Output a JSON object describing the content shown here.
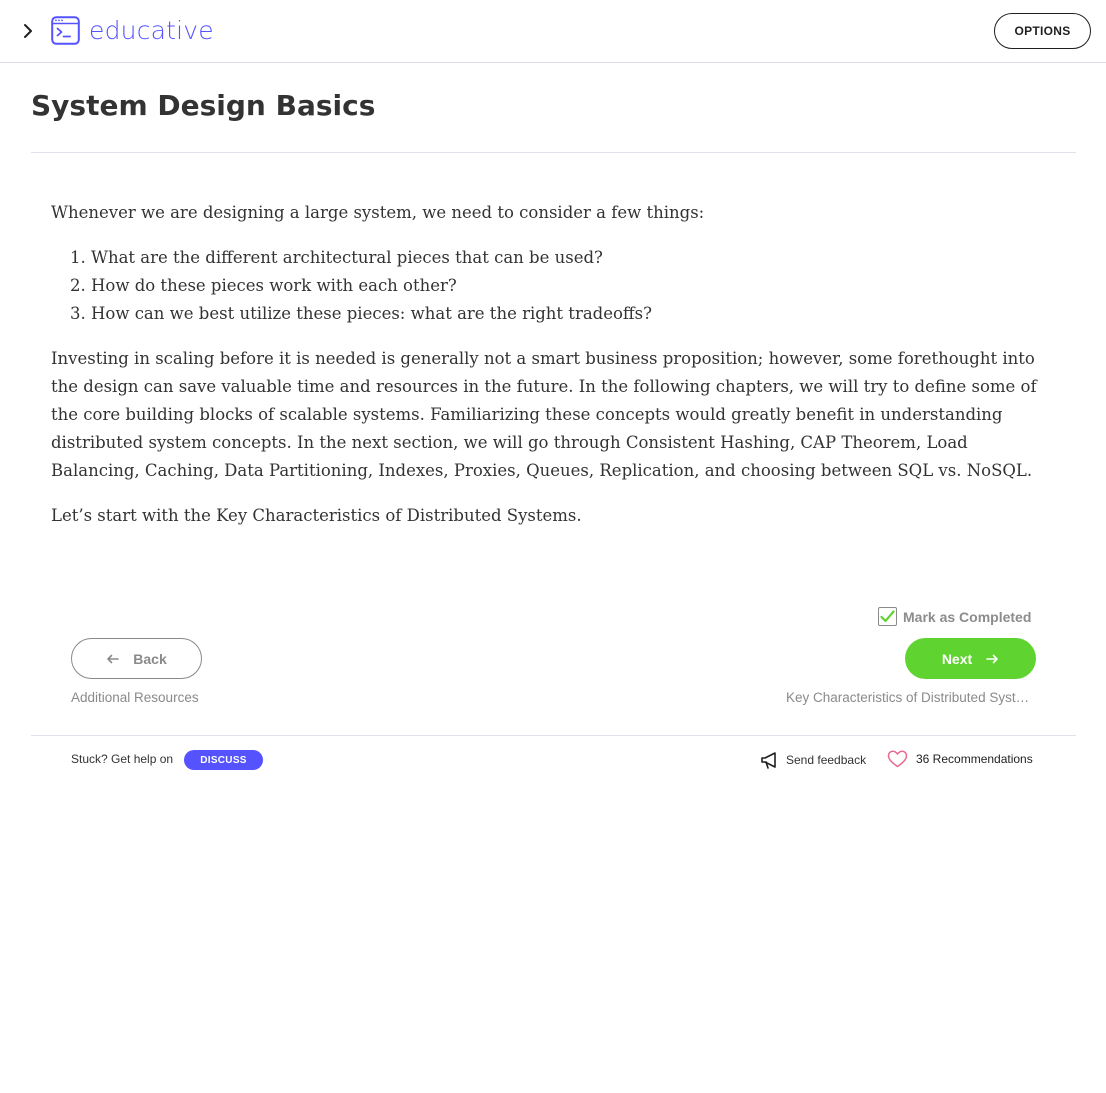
{
  "header": {
    "logo_text": "educative",
    "options_label": "OPTIONS",
    "brand_color": "#5553ff"
  },
  "page": {
    "title": "System Design Basics"
  },
  "content": {
    "intro": "Whenever we are designing a large system, we need to consider a few things:",
    "list": [
      "What are the different architectural pieces that can be used?",
      "How do these pieces work with each other?",
      "How can we best utilize these pieces: what are the right tradeoffs?"
    ],
    "paragraph": "Investing in scaling before it is needed is generally not a smart business proposition; however, some forethought into the design can save valuable time and resources in the future. In the following chapters, we will try to define some of the core building blocks of scalable systems. Familiarizing these concepts would greatly benefit in understanding distributed system concepts. In the next section, we will go through Consistent Hashing, CAP Theorem, Load Balancing, Caching, Data Partitioning, Indexes, Proxies, Queues, Replication, and choosing between SQL vs. NoSQL.",
    "closing": "Let’s start with the Key Characteristics of Distributed Systems."
  },
  "navigation": {
    "mark_completed_label": "Mark as Completed",
    "mark_completed_checked": true,
    "back_label": "Back",
    "next_label": "Next",
    "prev_lesson": "Additional Resources",
    "next_lesson": "Key Characteristics of Distributed Systems",
    "next_color": "#5fd32f"
  },
  "footer": {
    "stuck_text": "Stuck? Get help on",
    "discuss_label": "DISCUSS",
    "feedback_label": "Send feedback",
    "recommendations_label": "36 Recommendations"
  },
  "icons": {
    "expand": "chevron-right-icon",
    "logo": "terminal-window-icon",
    "back": "arrow-left-icon",
    "next": "arrow-right-icon",
    "feedback": "megaphone-icon",
    "recommendations": "heart-icon",
    "check": "checkmark-icon"
  }
}
